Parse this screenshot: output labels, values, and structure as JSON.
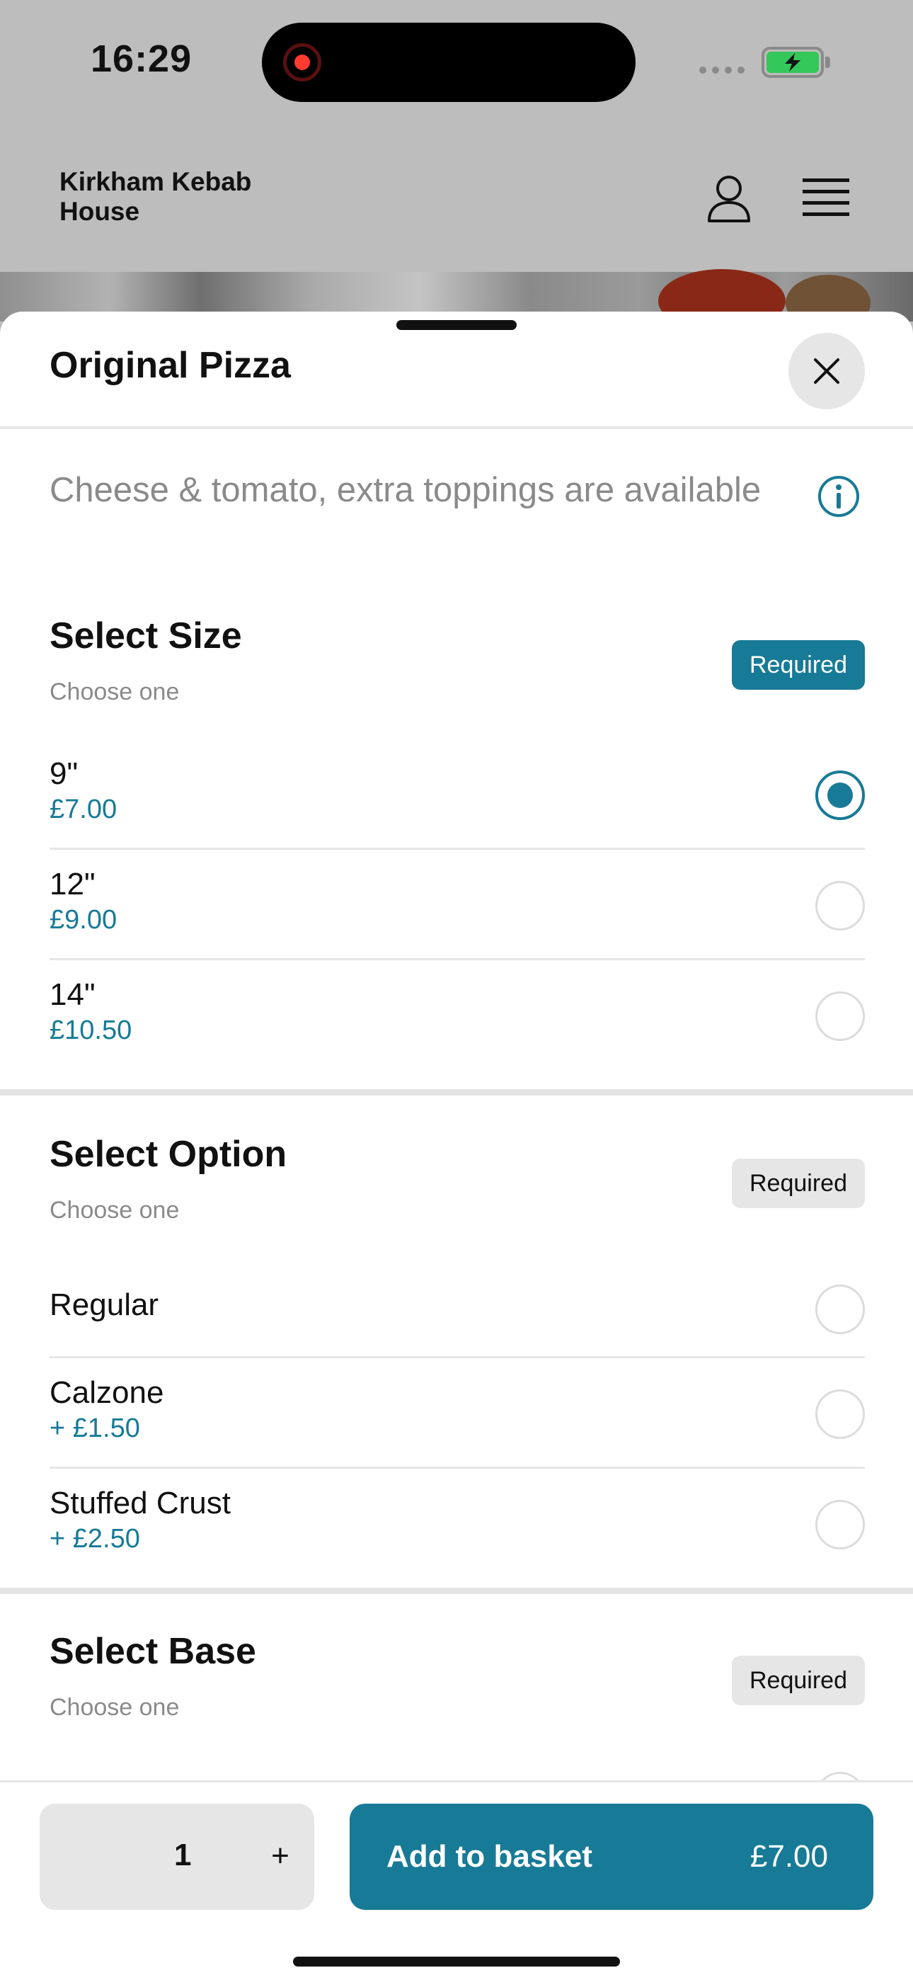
{
  "status_bar": {
    "time": "16:29"
  },
  "header": {
    "brand": "Kirkham Kebab House",
    "profile_icon": "person-icon",
    "menu_icon": "hamburger-menu-icon"
  },
  "sheet": {
    "title": "Original Pizza",
    "close_icon": "close-icon",
    "description": "Cheese & tomato, extra toppings are available",
    "info_icon": "info-icon"
  },
  "sections": [
    {
      "title": "Select Size",
      "subtitle": "Choose one",
      "badge": "Required",
      "options": [
        {
          "name": "9\"",
          "price": "£7.00",
          "selected": true
        },
        {
          "name": "12\"",
          "price": "£9.00",
          "selected": false
        },
        {
          "name": "14\"",
          "price": "£10.50",
          "selected": false
        }
      ]
    },
    {
      "title": "Select Option",
      "subtitle": "Choose one",
      "badge": "Required",
      "options": [
        {
          "name": "Regular",
          "price": "",
          "selected": false
        },
        {
          "name": "Calzone",
          "price": "+ £1.50",
          "selected": false
        },
        {
          "name": "Stuffed Crust",
          "price": "+ £2.50",
          "selected": false
        }
      ]
    },
    {
      "title": "Select Base",
      "subtitle": "Choose one",
      "badge": "Required"
    }
  ],
  "bottom_bar": {
    "quantity": "1",
    "plus": "+",
    "add_label": "Add to basket",
    "total": "£7.00"
  },
  "colors": {
    "accent": "#177a96",
    "badge_inactive": "#e6e6e6",
    "header_bg": "#bdbdbd"
  }
}
